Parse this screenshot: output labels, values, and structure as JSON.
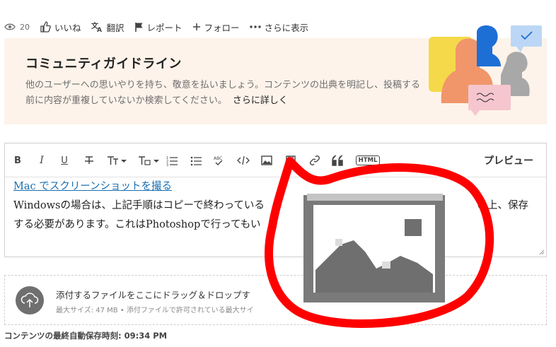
{
  "actions": {
    "views": "20",
    "like": "いいね",
    "translate": "翻訳",
    "report": "レポート",
    "follow": "フォロー",
    "more": "さらに表示"
  },
  "banner": {
    "title": "コミュニティガイドライン",
    "text": "他のユーザーへの思いやりを持ち、敬意を払いましょう。コンテンツの出典を明記し、投稿する前に内容が重複していないか検索してください。",
    "more_link": "さらに詳しく"
  },
  "toolbar": {
    "bold": "B",
    "italic": "I",
    "underline": "U",
    "html": "HTML",
    "preview": "プレビュー"
  },
  "editor": {
    "link_text": "Mac でスクリーンショットを撮る",
    "line1": "Windowsの場合は、上記手順はコピーで終わっている",
    "line1_tail": "の上、保存",
    "line2": "する必要があります。これはPhotoshopで行ってもい"
  },
  "upload": {
    "title": "添付するファイルをここにドラッグ＆ドロップす",
    "subtitle": "最大サイズ: 47 MB • 添付ファイルで許可されている最大サイ"
  },
  "autosave": "コンテンツの最終自動保存時刻: 09:34 PM",
  "colors": {
    "banner_bg": "#fdf3ea",
    "annotation_red": "#ff0000",
    "link": "#1a6fb0"
  }
}
